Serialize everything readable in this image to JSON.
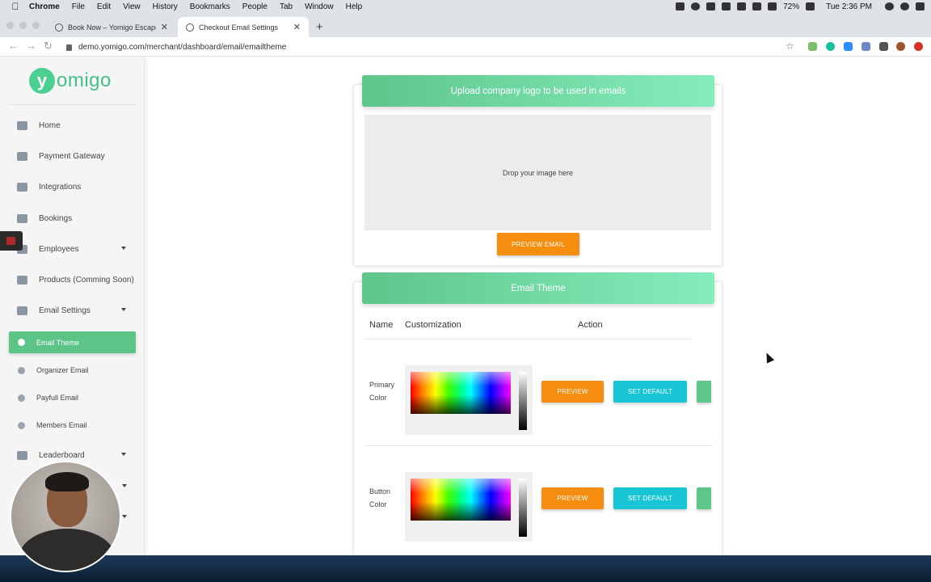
{
  "menubar": {
    "app": "Chrome",
    "items": [
      "File",
      "Edit",
      "View",
      "History",
      "Bookmarks",
      "People",
      "Tab",
      "Window",
      "Help"
    ],
    "battery": "72%",
    "clock": "Tue 2:36 PM"
  },
  "tabs": [
    {
      "title": "Book Now – Yomigo Escape Ro"
    },
    {
      "title": "Checkout Email Settings"
    }
  ],
  "address": {
    "url": "demo.yomigo.com/merchant/dashboard/email/emailtheme"
  },
  "logo": {
    "mark": "y",
    "word": "omigo"
  },
  "sidebar": {
    "items": [
      {
        "label": "Home",
        "icon": "home-icon"
      },
      {
        "label": "Payment Gateway",
        "icon": "credit-card-icon"
      },
      {
        "label": "Integrations",
        "icon": "sliders-icon"
      },
      {
        "label": "Bookings",
        "icon": "book-icon"
      },
      {
        "label": "Employees",
        "icon": "user-icon"
      },
      {
        "label": "Products (Comming Soon)",
        "icon": "grid-icon"
      },
      {
        "label": "Email Settings",
        "icon": "settings-icon"
      }
    ],
    "sub_items": [
      {
        "label": "Email Theme",
        "icon": "palette-icon"
      },
      {
        "label": "Organizer Email",
        "icon": "person-icon"
      },
      {
        "label": "Payfull Email",
        "icon": "person-icon"
      },
      {
        "label": "Members Email",
        "icon": "people-icon"
      }
    ],
    "leaderboard": "Leaderboard"
  },
  "logo_card": {
    "header": "Upload company logo to be used in emails",
    "dropzone": "Drop your image here",
    "preview_button": "PREVIEW EMAIL"
  },
  "theme_card": {
    "header": "Email Theme",
    "columns": [
      "Name",
      "Customization",
      "Action"
    ],
    "rows": [
      {
        "name_line1": "Primary",
        "name_line2": "Color",
        "preview": "PREVIEW",
        "set_default": "SET DEFAULT"
      },
      {
        "name_line1": "Button",
        "name_line2": "Color",
        "preview": "PREVIEW",
        "set_default": "SET DEFAULT"
      }
    ]
  },
  "colors": {
    "accent_green": "#5cc486",
    "header_gradient_end": "#84edbc",
    "preview_orange": "#f58d0f",
    "default_cyan": "#17c5d4"
  }
}
